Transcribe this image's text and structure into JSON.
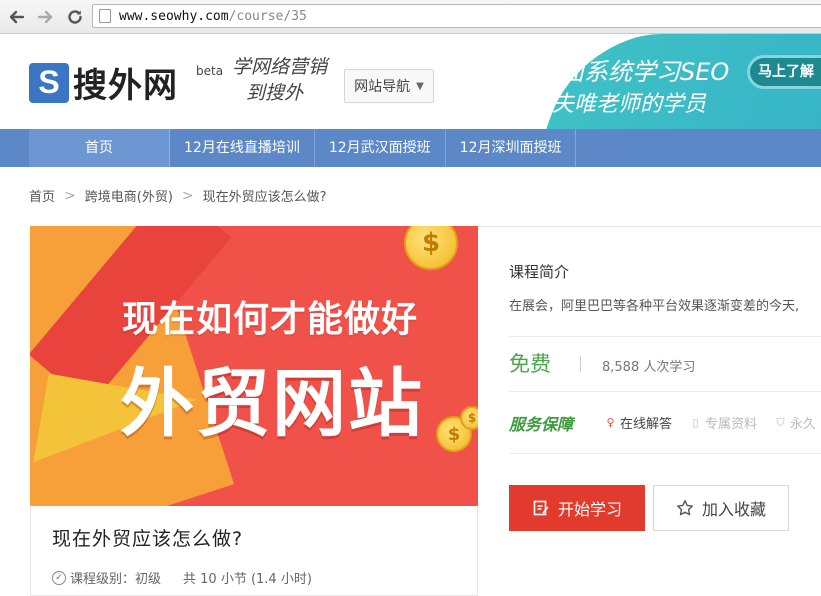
{
  "browser": {
    "url_host": "www.seowhy.com",
    "url_path": "/course/35"
  },
  "header": {
    "logo_letter": "S",
    "logo_text": "搜外网",
    "beta": "beta",
    "slogan_line1": "学网络营销",
    "slogan_line2": "到搜外",
    "site_nav_label": "网站导航",
    "banner_line1": "全面系统学习SEO",
    "banner_line2": "成为夫唯老师的学员",
    "banner_cta": "马上了解"
  },
  "nav": {
    "items": [
      {
        "label": "首页",
        "active": true
      },
      {
        "label": "12月在线直播培训"
      },
      {
        "label": "12月武汉面授班"
      },
      {
        "label": "12月深圳面授班"
      }
    ]
  },
  "breadcrumb": {
    "items": [
      "首页",
      "跨境电商(外贸)",
      "现在外贸应该怎么做?"
    ],
    "separator": ">"
  },
  "course": {
    "image_line1": "现在如何才能做好",
    "image_line2": "外贸网站",
    "title": "现在外贸应该怎么做?",
    "level": "课程级别：初级",
    "sections": "共 10 小节 (1.4 小时)"
  },
  "panel": {
    "intro_title": "课程简介",
    "intro_text": "在展会，阿里巴巴等各种平台效果逐渐变差的今天,",
    "price": "免费",
    "learners": "8,588 人次学习",
    "service_title": "服务保障",
    "services": [
      "在线解答",
      "专属资料",
      "永久"
    ],
    "start_button": "开始学习",
    "fav_button": "加入收藏"
  },
  "colors": {
    "nav_bg": "#5d88c7",
    "accent_red": "#e23b2e",
    "price_green": "#4aa44a",
    "banner_teal": "#3ec1c6"
  }
}
